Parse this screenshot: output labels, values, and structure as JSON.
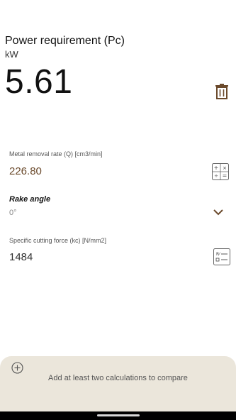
{
  "header": {
    "title": "Power requirement (Pc)",
    "unit": "kW",
    "value": "5.61"
  },
  "fields": {
    "metal_removal": {
      "label": "Metal removal rate (Q) [cm3/min]",
      "value": "226.80"
    },
    "rake_angle": {
      "label": "Rake angle",
      "value": "0°"
    },
    "specific_force": {
      "label": "Specific cutting force (kc) [N/mm2]",
      "value": "1484"
    }
  },
  "compare": {
    "text": "Add at least two calculations to compare"
  },
  "colors": {
    "accent": "#6b4a2c",
    "panel": "#ebe6db"
  },
  "icons": [
    "trash-icon",
    "calculator-icon",
    "chevron-down-icon",
    "formula-icon",
    "add-icon"
  ]
}
